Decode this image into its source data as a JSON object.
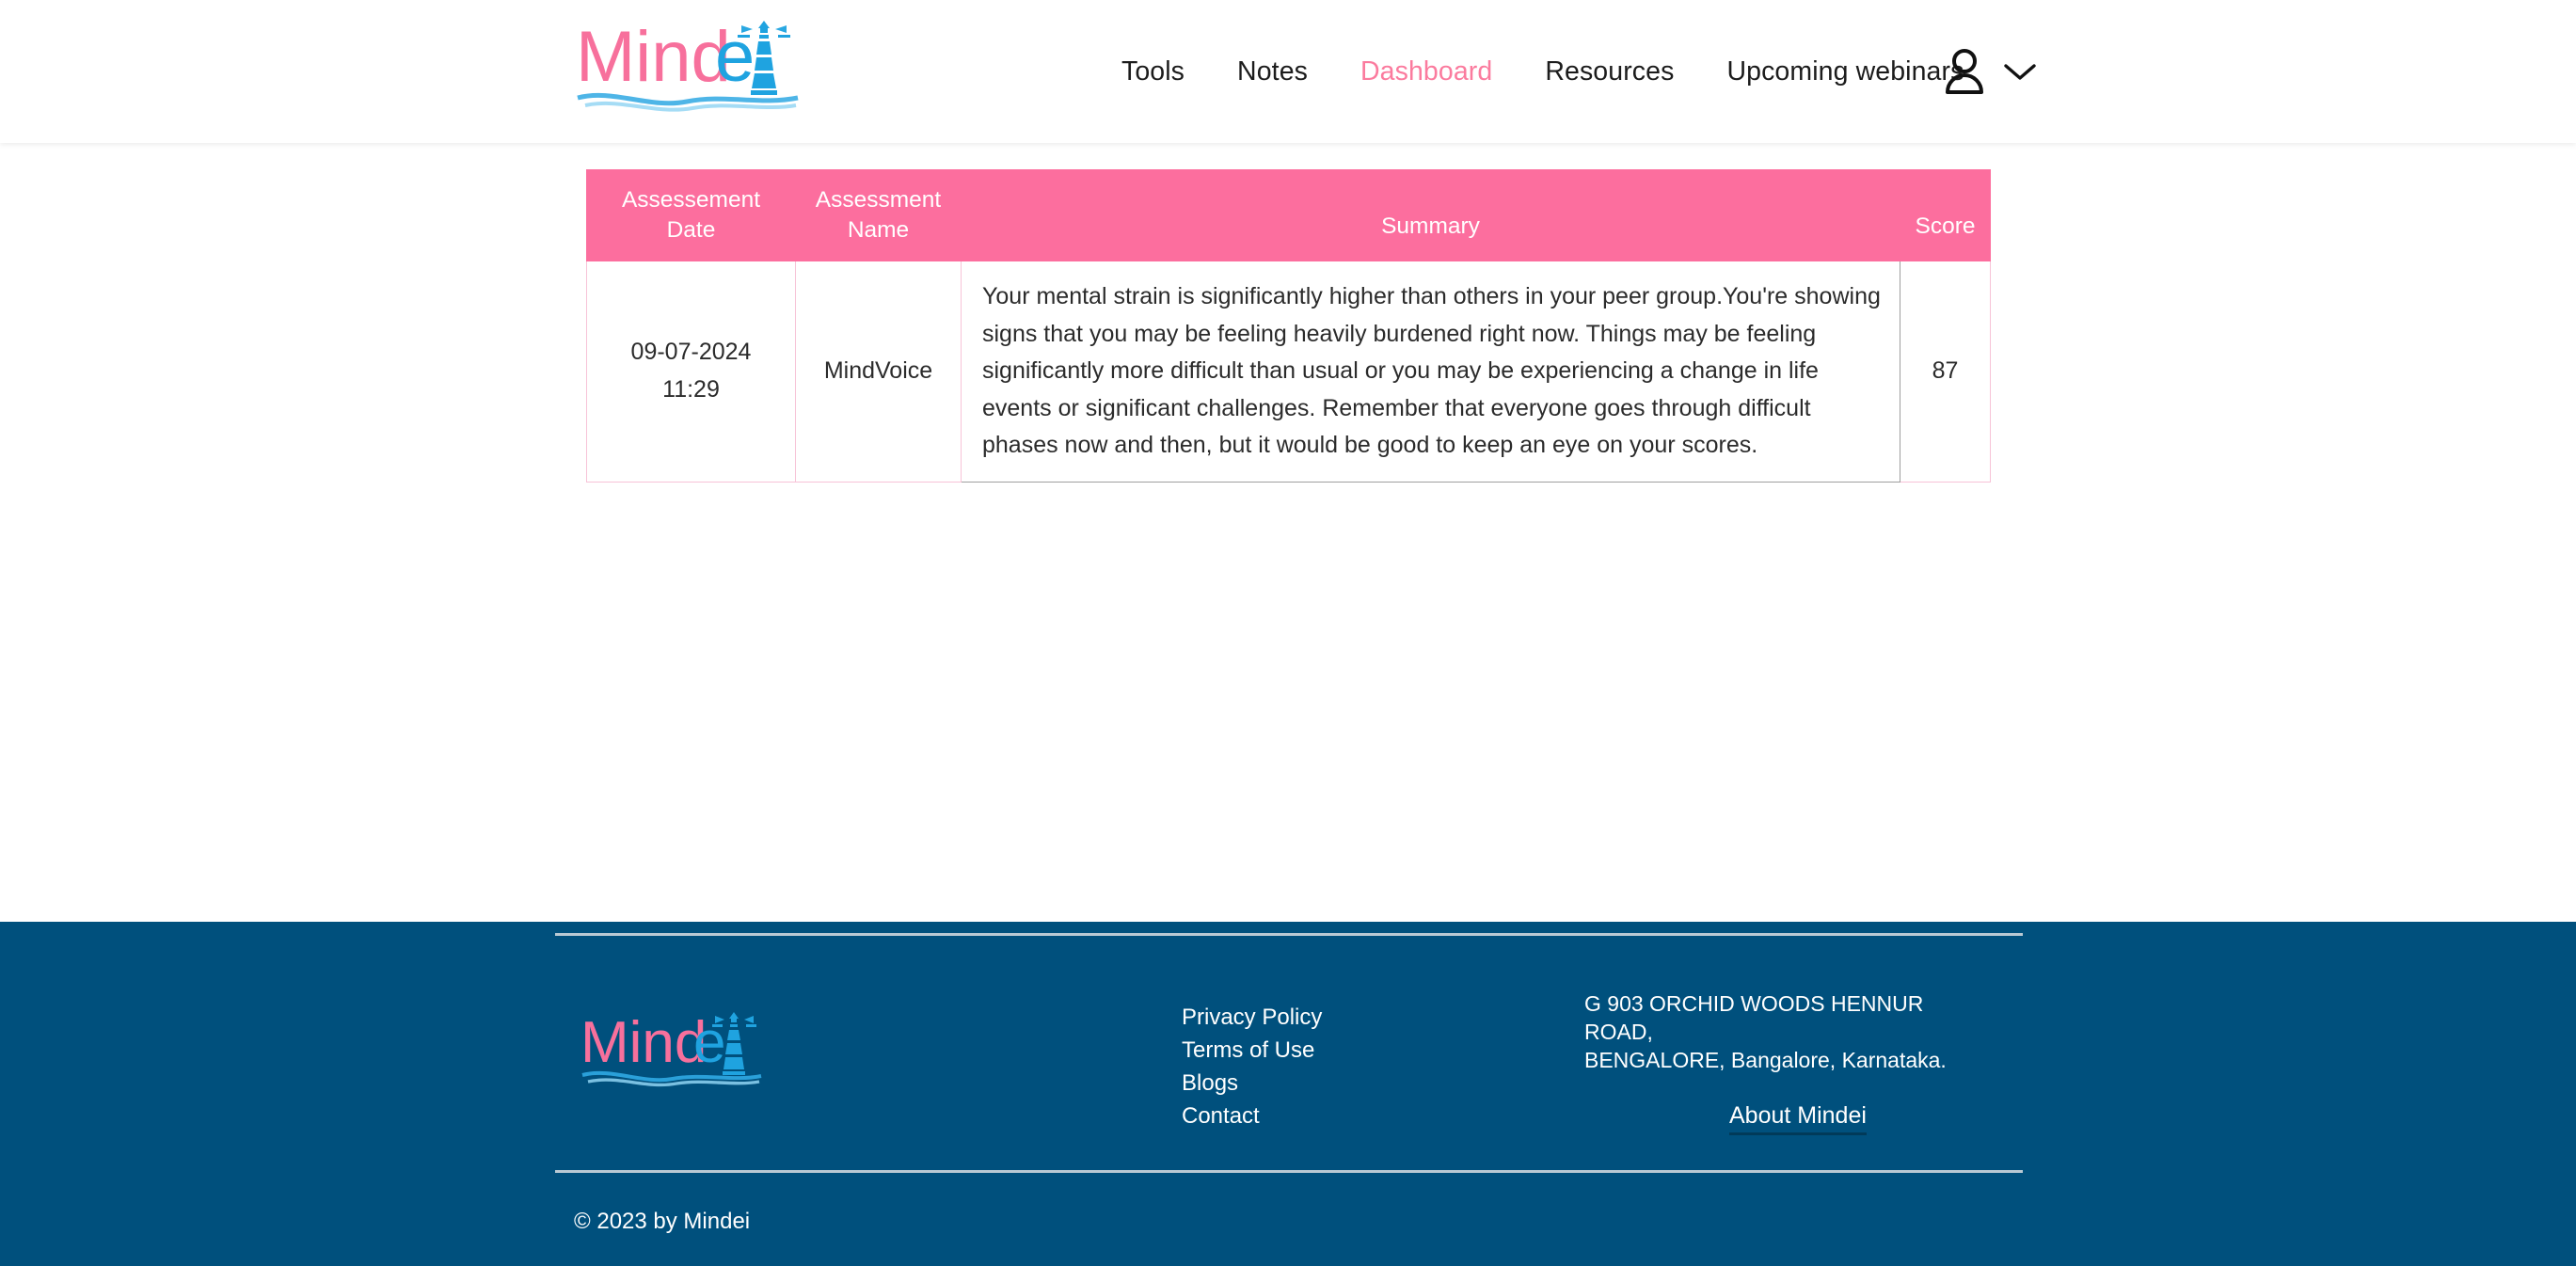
{
  "header": {
    "logo_text_pink": "Mind",
    "logo_text_blue": "e",
    "logo_alt": "Mindei",
    "nav": [
      {
        "label": "Tools",
        "active": false
      },
      {
        "label": "Notes",
        "active": false
      },
      {
        "label": "Dashboard",
        "active": true
      },
      {
        "label": "Resources",
        "active": false
      },
      {
        "label": "Upcoming webinars",
        "active": false
      }
    ],
    "user_menu_label": ""
  },
  "main": {
    "table": {
      "headers": {
        "date": "Assessement Date",
        "name": "Assessment Name",
        "summary": "Summary",
        "score": "Score"
      },
      "rows": [
        {
          "date": "09-07-2024 11:29",
          "name": "MindVoice",
          "summary": "Your mental strain is significantly higher than others in your peer group.You're showing signs that you may be feeling heavily burdened right now. Things may be feeling significantly more difficult than usual or you may be experiencing a change in life events or significant challenges. Remember that everyone goes through difficult phases now and then, but it would be good to keep an eye on your scores.",
          "score": "87"
        }
      ]
    }
  },
  "footer": {
    "logo_text_pink": "Mind",
    "logo_text_blue": "e",
    "links": [
      {
        "label": "Privacy Policy"
      },
      {
        "label": "Terms of Use"
      },
      {
        "label": "Blogs"
      },
      {
        "label": "Contact"
      }
    ],
    "address_line1": "G 903 ORCHID WOODS HENNUR ROAD,",
    "address_line2": "BENGALORE, Bangalore, Karnataka.",
    "about_label": "About Mindei",
    "copyright": "© 2023 by Mindei"
  },
  "colors": {
    "brand_pink": "#fc6e9e",
    "brand_blue": "#00507d",
    "logo_pink": "#f7709c",
    "logo_blue": "#1fa3e0",
    "table_border_pink": "#f7c3d7",
    "summary_border": "#9e9e9e",
    "nav_active": "#fb7b9e"
  }
}
